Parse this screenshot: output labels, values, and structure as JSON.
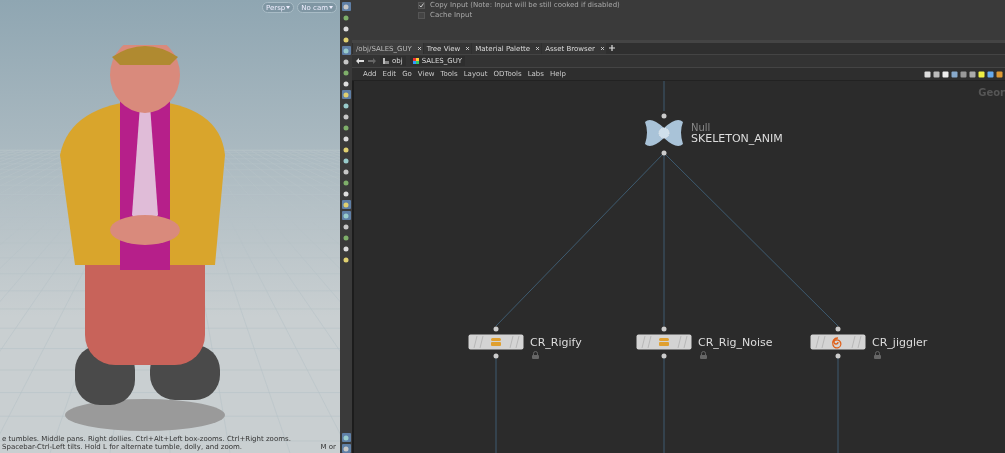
{
  "viewport": {
    "camera_buttons": [
      {
        "label": "Persp"
      },
      {
        "label": "No cam"
      }
    ],
    "status_text": "e tumbles. Middle pans. Right dollies. Ctrl+Alt+Left box-zooms. Ctrl+Right zooms. Spacebar-Ctrl-Left tilts. Hold L for alternate tumble, dolly, and zoom.",
    "status_hint": "M or"
  },
  "toolbar": [
    {
      "selected": true
    },
    {
      "selected": false
    },
    {
      "selected": false
    },
    {
      "selected": false
    },
    {
      "selected": true
    },
    {
      "selected": false
    },
    {
      "selected": false
    },
    {
      "selected": false
    },
    {
      "selected": true
    },
    {
      "selected": false
    },
    {
      "selected": false
    },
    {
      "selected": false
    },
    {
      "selected": false
    },
    {
      "selected": false
    },
    {
      "selected": false
    },
    {
      "selected": false
    },
    {
      "selected": false
    },
    {
      "selected": false
    },
    {
      "selected": true
    },
    {
      "selected": true
    },
    {
      "selected": false
    },
    {
      "selected": false
    },
    {
      "selected": false
    },
    {
      "selected": false
    },
    {
      "selected": true
    },
    {
      "selected": true
    }
  ],
  "parameters": [
    {
      "kind": "checkbox",
      "label": "Copy Input (Note: Input will be still cooked if disabled)",
      "checked": true
    },
    {
      "kind": "checkbox",
      "label": "Cache Input",
      "checked": false
    }
  ],
  "tabs": [
    {
      "label": "/obj/SALES_GUY",
      "selected": true
    },
    {
      "label": "Tree View",
      "selected": false
    },
    {
      "label": "Material Palette",
      "selected": false
    },
    {
      "label": "Asset Browser",
      "selected": false
    }
  ],
  "path": [
    {
      "label": "obj"
    },
    {
      "label": "SALES_GUY"
    }
  ],
  "menu": [
    "Add",
    "Edit",
    "Go",
    "View",
    "Tools",
    "Layout",
    "ODTools",
    "Labs",
    "Help"
  ],
  "network": {
    "context_label": "Geor",
    "nodes": [
      {
        "kind": "null",
        "type": "Null",
        "name": "SKELETON_ANIM",
        "locked": false
      },
      {
        "kind": "subnet",
        "name": "CR_Rigify",
        "locked": true
      },
      {
        "kind": "subnet",
        "name": "CR_Rig_Noise",
        "locked": true
      },
      {
        "kind": "spiral",
        "name": "CR_jiggler",
        "locked": true
      }
    ]
  }
}
